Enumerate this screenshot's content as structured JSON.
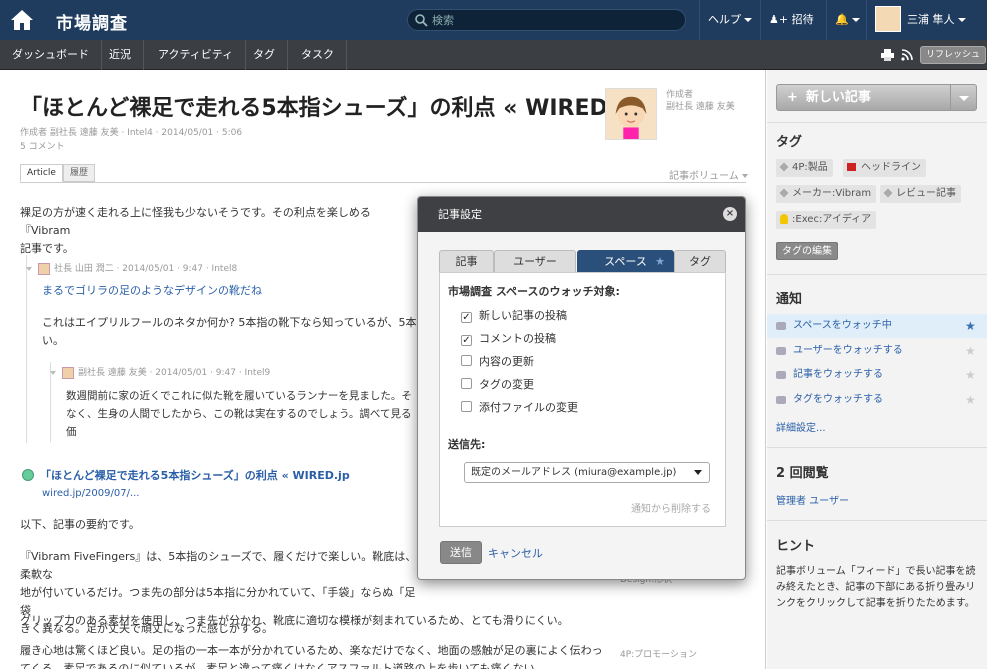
{
  "header": {
    "app_title": "市場調査",
    "search_placeholder": "検索",
    "help_label": "ヘルプ",
    "invite_label": "招待",
    "user_name": "三浦 隼人"
  },
  "nav": {
    "items": [
      "ダッシュボード",
      "近況",
      "アクティビティ",
      "タグ",
      "タスク"
    ],
    "refresh_label": "リフレッシュ"
  },
  "article": {
    "title": "「ほとんど裸足で走れる5本指シューズ」の利点 « WIRED.jp",
    "meta": "作成者 副社長 遠藤 友美 · Intel4 · 2014/05/01 · 5:06",
    "comments": "5 コメント",
    "author_label": "作成者",
    "author_name": "副社長 遠藤 友美",
    "tabs": [
      "Article",
      "履歴"
    ],
    "volume_label": "記事ボリューム",
    "intro_1": "裸足の方が速く走れる上に怪我も少ないそうです。その利点を楽しめる『Vibram",
    "intro_2": "記事です。",
    "comment1_meta": "社長 山田 潤二 · 2014/05/01 · 9:47 · Intel8",
    "comment1_title": "まるでゴリラの足のようなデザインの靴だね",
    "comment1_body_1": "これはエイプリルフールのネタか何か? 5本指の靴下なら知っているが、5本",
    "comment1_body_2": "い。",
    "comment2_meta": "副社長 遠藤 友美 · 2014/05/01 · 9:47 · Intel9",
    "comment2_body_1": "数週間前に家の近くでこれに似た靴を履いているランナーを見ました。そ",
    "comment2_body_2": "なく、生身の人間でしたから、この靴は実在するのでしょう。調べて見る価",
    "link_title": "「ほとんど裸足で走れる5本指シューズ」の利点 « WIRED.jp",
    "link_url": "wired.jp/2009/07/...",
    "summary_heading": "以下、記事の要約です。",
    "para1_1": "『Vibram FiveFingers』は、5本指のシューズで、履くだけで楽しい。靴底は、柔軟な",
    "para1_2": "地が付いているだけ。つま先の部分は5本指に分かれていて、「手袋」ならぬ「足袋",
    "para1_3": "きく異なる。足が丈夫で頑丈になった感じがする。",
    "para2": "グリップ力のある素材を使用し、つま先が分かれ、靴底に適切な模様が刻まれているため、とても滑りにくい。",
    "para3_1": "履き心地は驚くほど良い。足の指の一本一本が分かれているため、楽なだけでなく、地面の感触が足の裏によく伝わっ",
    "para3_2": "てくる。素足であるのに似ているが、素足と違って痛くはなくアスファルト道路の上を歩いても痛くない",
    "side_label_1": "Design:形状",
    "side_label_2": "4P:プロモーション"
  },
  "sidebar": {
    "new_post_label": "新しい記事",
    "tags_heading": "タグ",
    "tags": [
      "4P:製品",
      "ヘッドライン",
      "メーカー:Vibram",
      "レビュー記事",
      ":Exec:アイディア"
    ],
    "tag_edit_label": "タグの編集",
    "notify_heading": "通知",
    "notify_items": [
      "スペースをウォッチ中",
      "ユーザーをウォッチする",
      "記事をウォッチする",
      "タグをウォッチする"
    ],
    "notify_more": "詳細設定...",
    "views_heading": "2 回閲覧",
    "views_link": "管理者 ユーザー",
    "hint_heading": "ヒント",
    "hint_text": "記事ボリューム「フィード」で長い記事を読み終えたとき、記事の下部にある折り畳みリンクをクリックして記事を折りたためます。"
  },
  "dialog": {
    "title": "記事設定",
    "tabs": [
      "記事",
      "ユーザー",
      "スペース",
      "タグ"
    ],
    "watch_label": "市場調査 スペースのウォッチ対象:",
    "options": [
      {
        "label": "新しい記事の投稿",
        "checked": true
      },
      {
        "label": "コメントの投稿",
        "checked": true
      },
      {
        "label": "内容の更新",
        "checked": false
      },
      {
        "label": "タグの変更",
        "checked": false
      },
      {
        "label": "添付ファイルの変更",
        "checked": false
      }
    ],
    "send_to_label": "送信先:",
    "send_to_value": "既定のメールアドレス (miura@example.jp)",
    "remove_label": "通知から削除する",
    "send_button": "送信",
    "cancel_link": "キャンセル"
  },
  "colors": {
    "topbar": "#1f3c5e",
    "navbar": "#3b3f44",
    "accent": "#2a4f7a",
    "link": "#2a5fa8"
  }
}
